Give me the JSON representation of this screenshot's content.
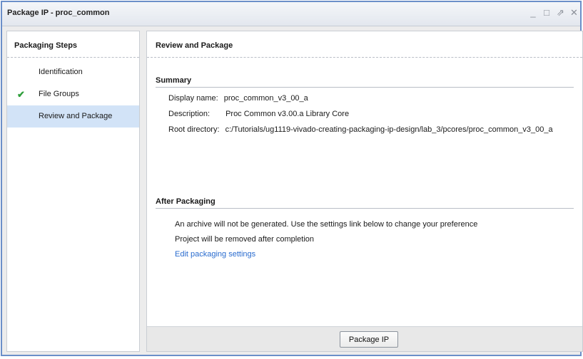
{
  "window": {
    "title": "Package IP - proc_common",
    "controls": {
      "minimize": "_",
      "maximize": "□",
      "restore": "⇗",
      "close": "✕"
    }
  },
  "sidebar": {
    "header": "Packaging Steps",
    "steps": [
      {
        "label": "Identification",
        "completed": false,
        "selected": false
      },
      {
        "label": "File Groups",
        "completed": true,
        "selected": false
      },
      {
        "label": "Review and Package",
        "completed": false,
        "selected": true
      }
    ]
  },
  "main": {
    "header": "Review and Package",
    "summary": {
      "title": "Summary",
      "display_name_label": "Display name:",
      "display_name": "proc_common_v3_00_a",
      "description_label": "Description:",
      "description": "Proc Common v3.00.a Library Core",
      "root_dir_label": "Root directory:",
      "root_dir": "c:/Tutorials/ug1119-vivado-creating-packaging-ip-design/lab_3/pcores/proc_common_v3_00_a"
    },
    "after": {
      "title": "After Packaging",
      "line1": "An archive will not be generated. Use the settings link below to change your preference",
      "line2": "Project will be removed after completion",
      "link": "Edit packaging settings"
    },
    "package_button": "Package IP"
  },
  "colors": {
    "accent_border": "#6b8fc9",
    "selected_bg": "#d2e3f7",
    "check": "#2e9e3a",
    "link": "#2a6ccf"
  }
}
